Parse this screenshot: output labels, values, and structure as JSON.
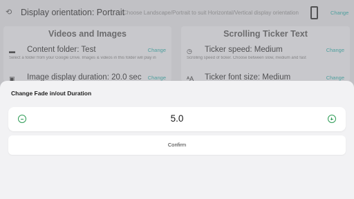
{
  "header": {
    "title": "Display orientation: Portrait",
    "subtitle": "Choose Landscape/Portrait to suit Horizontal/Vertical display orientation",
    "change_label": "Change",
    "left_icon": "rotate-icon",
    "right_icon": "phone-portrait-icon"
  },
  "left_card": {
    "title": "Videos and Images",
    "rows": [
      {
        "icon": "folder-icon",
        "label": "Content folder: Test",
        "change": "Change",
        "help": "Select a folder from your Google Drive. Images & videos in this folder will play in"
      },
      {
        "icon": "image-icon",
        "label": "Image display duration: 20.0 sec",
        "change": "Change",
        "help": ""
      }
    ]
  },
  "right_card": {
    "title": "Scrolling Ticker Text",
    "rows": [
      {
        "icon": "clock-icon",
        "label": "Ticker speed: Medium",
        "change": "Change",
        "help": "Scrolling speed of ticker. Choose between slow, medium and fast"
      },
      {
        "icon": "font-size-icon",
        "label": "Ticker font size: Medium",
        "change": "Change",
        "help": ""
      }
    ]
  },
  "dialog": {
    "title": "Change Fade in/out Duration",
    "value": "5.0",
    "confirm_label": "Confirm"
  },
  "colors": {
    "accent": "#2aa5a0",
    "stepper_green": "#2e9c56"
  }
}
